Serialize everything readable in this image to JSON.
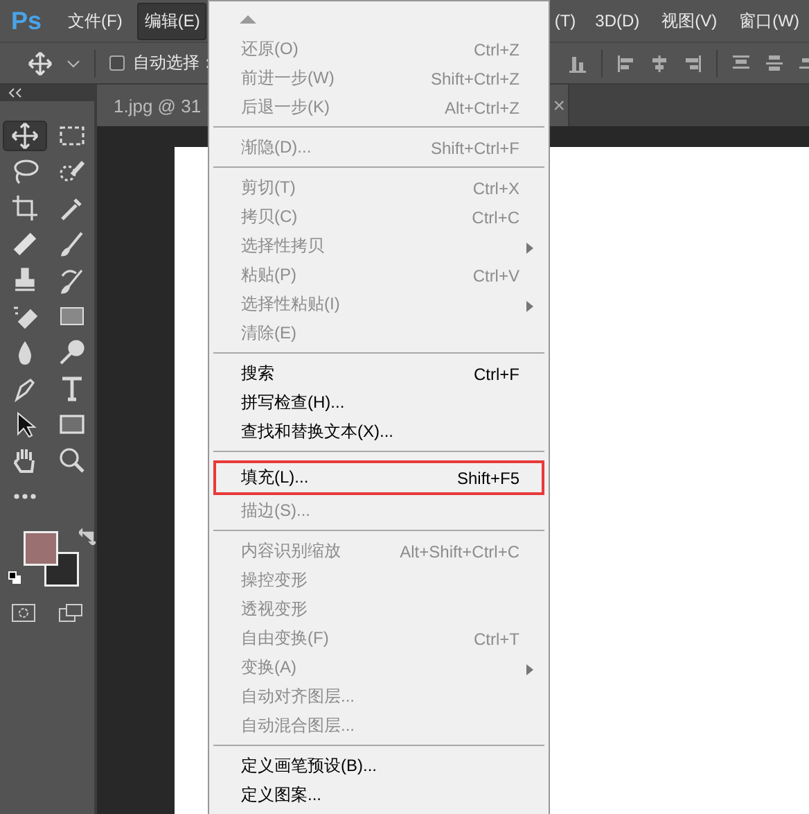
{
  "app": {
    "logo": "Ps"
  },
  "menubar": [
    {
      "label": "文件(F)",
      "selected": false
    },
    {
      "label": "编辑(E)",
      "selected": true
    }
  ],
  "menubar_right": [
    "(T)",
    "3D(D)",
    "视图(V)",
    "窗口(W)"
  ],
  "options_bar": {
    "auto_select": {
      "label": "自动选择：",
      "checked": false
    }
  },
  "document_tab": {
    "title": "1.jpg @ 31",
    "close": "×"
  },
  "tools": [
    {
      "kind": "move",
      "selected": true
    },
    {
      "kind": "marquee",
      "selected": false
    },
    {
      "kind": "lasso",
      "selected": false
    },
    {
      "kind": "quick-select",
      "selected": false
    },
    {
      "kind": "crop",
      "selected": false
    },
    {
      "kind": "eyedropper",
      "selected": false
    },
    {
      "kind": "healing",
      "selected": false
    },
    {
      "kind": "brush",
      "selected": false
    },
    {
      "kind": "stamp",
      "selected": false
    },
    {
      "kind": "history-brush",
      "selected": false
    },
    {
      "kind": "eraser",
      "selected": false
    },
    {
      "kind": "gradient",
      "selected": false
    },
    {
      "kind": "drop",
      "selected": false
    },
    {
      "kind": "dodge",
      "selected": false
    },
    {
      "kind": "pen",
      "selected": false
    },
    {
      "kind": "type",
      "selected": false
    },
    {
      "kind": "arrow",
      "selected": false
    },
    {
      "kind": "rectangle",
      "selected": false
    },
    {
      "kind": "hand",
      "selected": false
    },
    {
      "kind": "zoom",
      "selected": false
    },
    {
      "kind": "more",
      "selected": false
    }
  ],
  "swatches": [
    {
      "color": "#9b7070"
    },
    {
      "color": "#2b2b2b"
    }
  ],
  "edit_menu": [
    {
      "kind": "scroll"
    },
    {
      "kind": "item",
      "label": "还原(O)",
      "shortcut": "Ctrl+Z",
      "disabled": true,
      "submenu": false,
      "outlined": false
    },
    {
      "kind": "item",
      "label": "前进一步(W)",
      "shortcut": "Shift+Ctrl+Z",
      "disabled": true,
      "submenu": false,
      "outlined": false
    },
    {
      "kind": "item",
      "label": "后退一步(K)",
      "shortcut": "Alt+Ctrl+Z",
      "disabled": true,
      "submenu": false,
      "outlined": false
    },
    {
      "kind": "separator"
    },
    {
      "kind": "item",
      "label": "渐隐(D)...",
      "shortcut": "Shift+Ctrl+F",
      "disabled": true,
      "submenu": false,
      "outlined": false
    },
    {
      "kind": "separator"
    },
    {
      "kind": "item",
      "label": "剪切(T)",
      "shortcut": "Ctrl+X",
      "disabled": true,
      "submenu": false,
      "outlined": false
    },
    {
      "kind": "item",
      "label": "拷贝(C)",
      "shortcut": "Ctrl+C",
      "disabled": true,
      "submenu": false,
      "outlined": false
    },
    {
      "kind": "item",
      "label": "选择性拷贝",
      "disabled": true,
      "submenu": true,
      "outlined": false
    },
    {
      "kind": "item",
      "label": "粘贴(P)",
      "shortcut": "Ctrl+V",
      "disabled": true,
      "submenu": false,
      "outlined": false
    },
    {
      "kind": "item",
      "label": "选择性粘贴(I)",
      "disabled": true,
      "submenu": true,
      "outlined": false
    },
    {
      "kind": "item",
      "label": "清除(E)",
      "disabled": true,
      "submenu": false,
      "outlined": false
    },
    {
      "kind": "separator"
    },
    {
      "kind": "item",
      "label": "搜索",
      "shortcut": "Ctrl+F",
      "disabled": false,
      "submenu": false,
      "outlined": false
    },
    {
      "kind": "item",
      "label": "拼写检查(H)...",
      "disabled": false,
      "submenu": false,
      "outlined": false
    },
    {
      "kind": "item",
      "label": "查找和替换文本(X)...",
      "disabled": false,
      "submenu": false,
      "outlined": false
    },
    {
      "kind": "separator"
    },
    {
      "kind": "item",
      "label": "填充(L)...",
      "shortcut": "Shift+F5",
      "disabled": false,
      "submenu": false,
      "outlined": true
    },
    {
      "kind": "item",
      "label": "描边(S)...",
      "disabled": true,
      "submenu": false,
      "outlined": false
    },
    {
      "kind": "separator"
    },
    {
      "kind": "item",
      "label": "内容识别缩放",
      "shortcut": "Alt+Shift+Ctrl+C",
      "disabled": true,
      "submenu": false,
      "outlined": false
    },
    {
      "kind": "item",
      "label": "操控变形",
      "disabled": true,
      "submenu": false,
      "outlined": false
    },
    {
      "kind": "item",
      "label": "透视变形",
      "disabled": true,
      "submenu": false,
      "outlined": false
    },
    {
      "kind": "item",
      "label": "自由变换(F)",
      "shortcut": "Ctrl+T",
      "disabled": true,
      "submenu": false,
      "outlined": false
    },
    {
      "kind": "item",
      "label": "变换(A)",
      "disabled": true,
      "submenu": true,
      "outlined": false
    },
    {
      "kind": "item",
      "label": "自动对齐图层...",
      "disabled": true,
      "submenu": false,
      "outlined": false
    },
    {
      "kind": "item",
      "label": "自动混合图层...",
      "disabled": true,
      "submenu": false,
      "outlined": false
    },
    {
      "kind": "separator"
    },
    {
      "kind": "item",
      "label": "定义画笔预设(B)...",
      "disabled": false,
      "submenu": false,
      "outlined": false
    },
    {
      "kind": "item",
      "label": "定义图案...",
      "disabled": false,
      "submenu": false,
      "outlined": false
    }
  ]
}
